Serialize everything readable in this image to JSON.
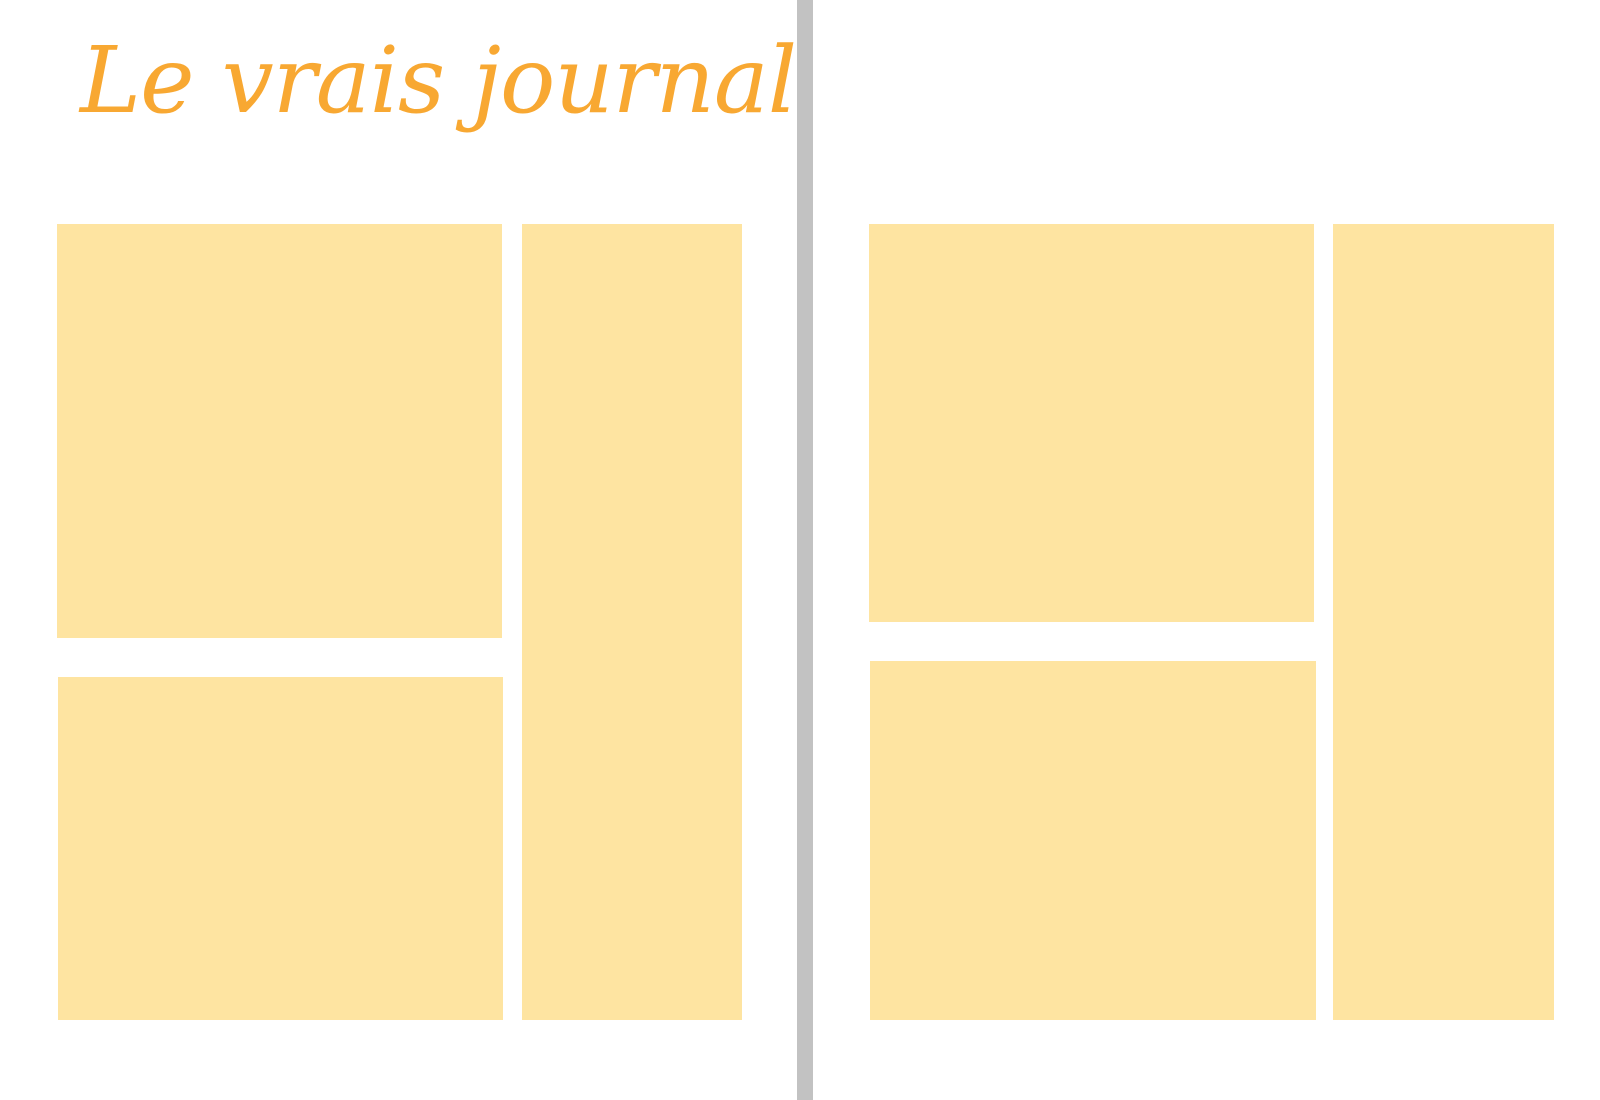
{
  "document": {
    "title": "Le vrais journal",
    "accent_color": "#f8a832",
    "placeholder_color": "#fee4a1",
    "gutter_color": "#c2c2c2"
  }
}
